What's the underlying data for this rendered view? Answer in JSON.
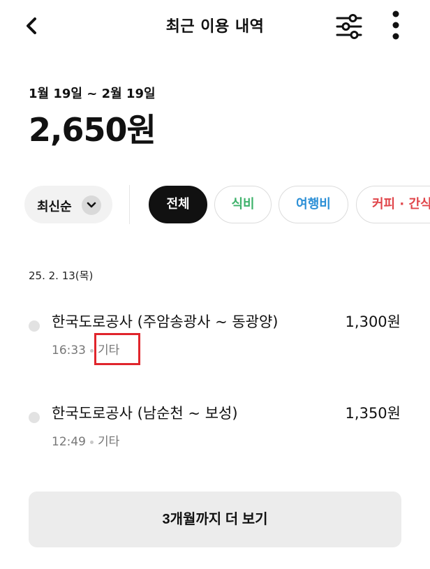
{
  "header": {
    "title": "최근 이용 내역",
    "back_icon": "chevron-left-icon",
    "filter_icon": "sliders-icon",
    "more_icon": "more-vertical-icon"
  },
  "summary": {
    "period": "1월 19일 ~ 2월 19일",
    "total": "2,650원"
  },
  "sort": {
    "label": "최신순",
    "icon": "chevron-down-icon"
  },
  "categories": [
    {
      "label": "전체",
      "selected": true,
      "color": "#111111"
    },
    {
      "label": "식비",
      "selected": false,
      "color": "#3db16a"
    },
    {
      "label": "여행비",
      "selected": false,
      "color": "#2b8fd6"
    },
    {
      "label": "커피 · 간식",
      "selected": false,
      "color": "#e0454a"
    }
  ],
  "date_group": "25. 2. 13(목)",
  "transactions": [
    {
      "name": "한국도로공사 (주암송광사 ~ 동광양)",
      "amount": "1,300원",
      "time": "16:33",
      "category": "기타"
    },
    {
      "name": "한국도로공사 (남순천 ~ 보성)",
      "amount": "1,350원",
      "time": "12:49",
      "category": "기타"
    }
  ],
  "load_more": "3개월까지 더 보기",
  "colors": {
    "highlight": "#e0252c",
    "chip_selected_bg": "#111111",
    "button_bg": "#ececec"
  }
}
